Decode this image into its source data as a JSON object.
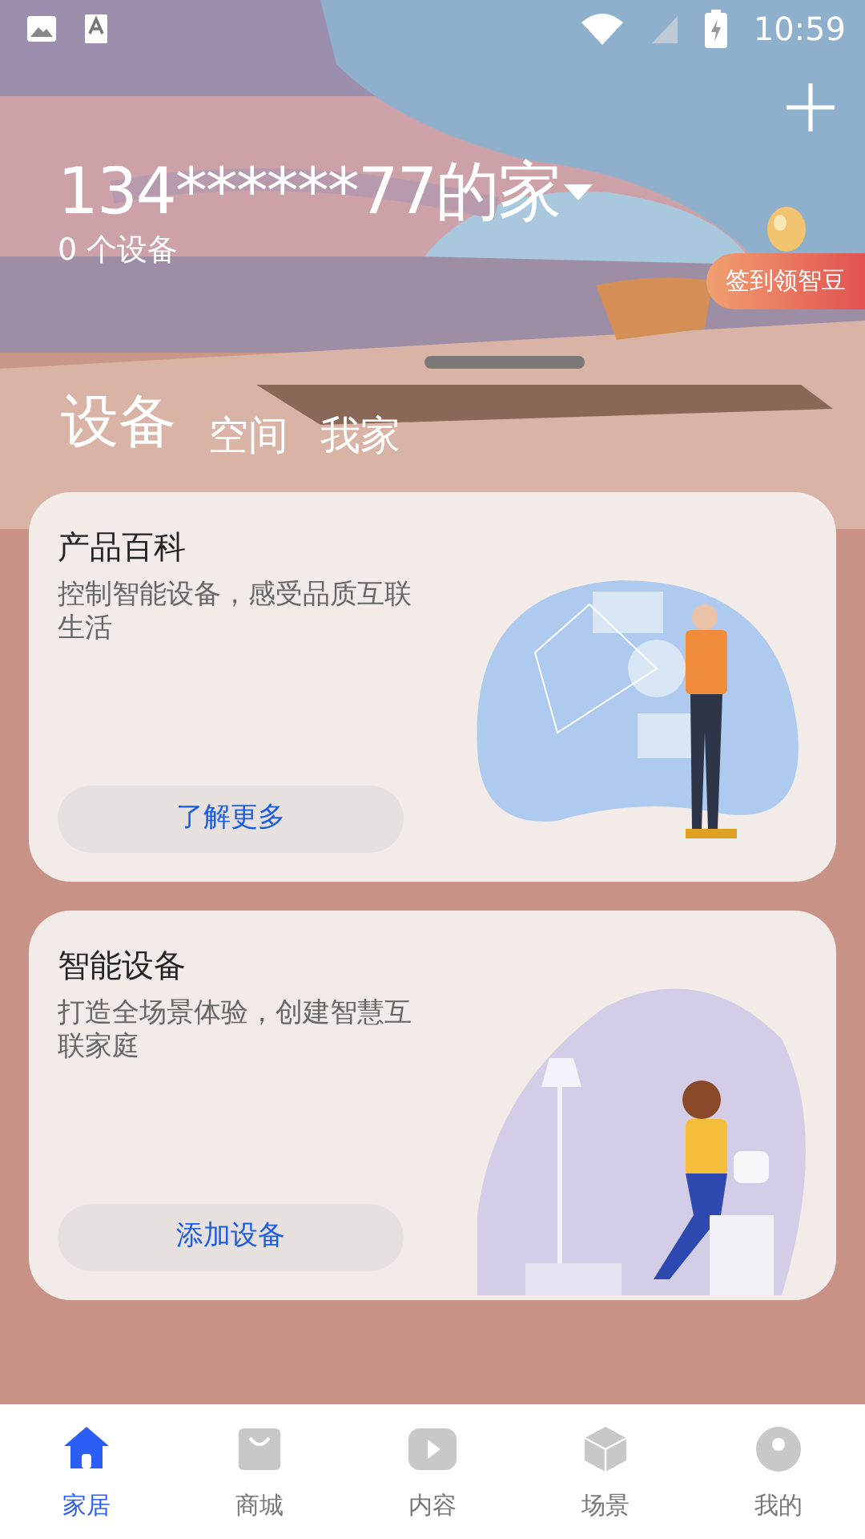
{
  "status_bar": {
    "time": "10:59"
  },
  "header": {
    "title": "134******77的家",
    "device_count": "0 个设备",
    "checkin_badge": "签到领智豆"
  },
  "tabs": [
    {
      "label": "设备",
      "selected": true
    },
    {
      "label": "空间",
      "selected": false
    },
    {
      "label": "我家",
      "selected": false
    }
  ],
  "cards": [
    {
      "kind": "product",
      "title": "产品百科",
      "description": "控制智能设备，感受品质互联生活",
      "button": "了解更多"
    },
    {
      "kind": "devices",
      "title": "智能设备",
      "description": "打造全场景体验，创建智慧互联家庭",
      "button": "添加设备"
    }
  ],
  "bottom_nav": [
    {
      "label": "家居",
      "kind": "home",
      "selected": true
    },
    {
      "label": "商城",
      "kind": "shop",
      "selected": false
    },
    {
      "label": "内容",
      "kind": "play",
      "selected": false
    },
    {
      "label": "场景",
      "kind": "cube",
      "selected": false
    },
    {
      "label": "我的",
      "kind": "user",
      "selected": false
    }
  ]
}
